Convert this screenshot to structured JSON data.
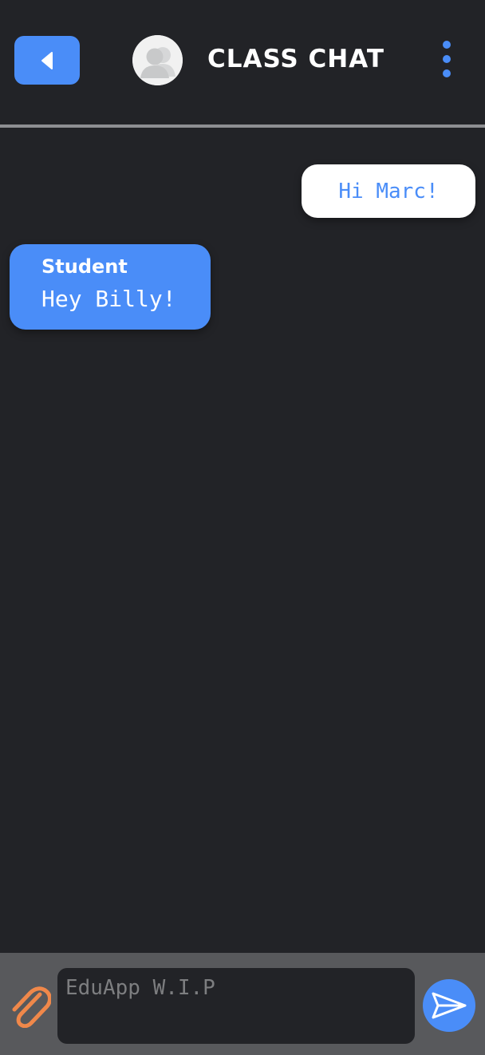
{
  "header": {
    "title": "CLASS CHAT",
    "back_icon": "back-triangle-icon",
    "avatar_icon": "group-avatar-icon",
    "menu_icon": "kebab-menu-icon"
  },
  "messages": [
    {
      "direction": "outgoing",
      "text": "Hi Marc!"
    },
    {
      "direction": "incoming",
      "sender": "Student",
      "text": "Hey Billy!"
    }
  ],
  "composer": {
    "placeholder": "EduApp W.I.P",
    "attach_icon": "paperclip-icon",
    "send_icon": "send-icon"
  },
  "colors": {
    "background": "#222327",
    "accent": "#4a8df8",
    "composer_bar": "#58595c",
    "divider": "#8e8f92",
    "attach": "#f0884a",
    "sent_bubble": "#ffffff"
  }
}
